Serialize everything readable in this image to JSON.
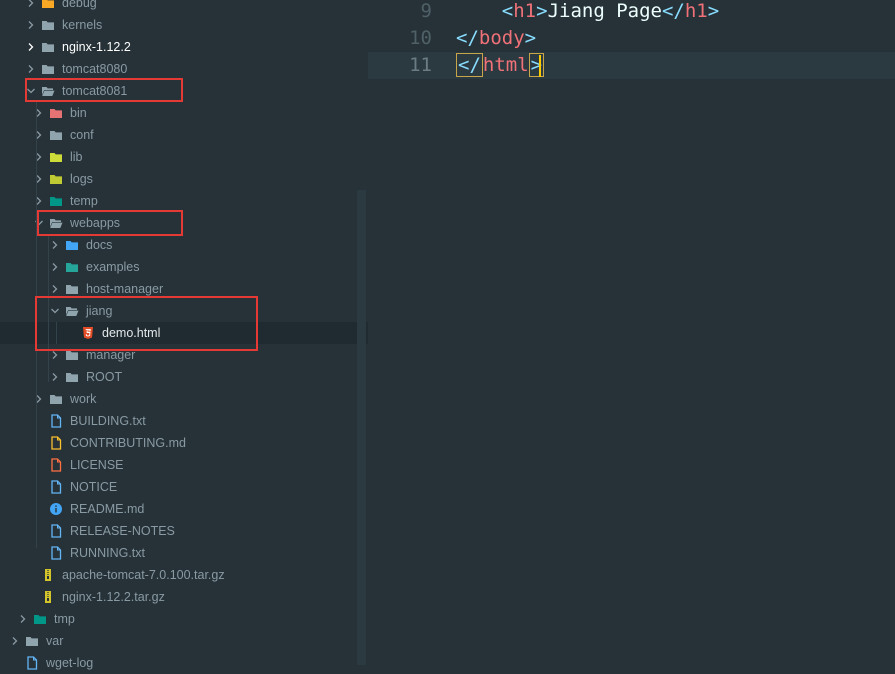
{
  "explorer": {
    "items": [
      {
        "label": "debug",
        "icon": "debug-folder-icon",
        "expanded": false
      },
      {
        "label": "kernels",
        "icon": "folder-icon",
        "expanded": false
      },
      {
        "label": "nginx-1.12.2",
        "icon": "folder-icon",
        "expanded": false
      },
      {
        "label": "tomcat8080",
        "icon": "folder-icon",
        "expanded": false
      },
      {
        "label": "tomcat8081",
        "icon": "folder-open-icon",
        "expanded": true
      },
      {
        "label": "bin",
        "icon": "bin-folder-icon",
        "expanded": false
      },
      {
        "label": "conf",
        "icon": "folder-icon",
        "expanded": false
      },
      {
        "label": "lib",
        "icon": "lib-folder-icon",
        "expanded": false
      },
      {
        "label": "logs",
        "icon": "logs-folder-icon",
        "expanded": false
      },
      {
        "label": "temp",
        "icon": "temp-folder-icon",
        "expanded": false
      },
      {
        "label": "webapps",
        "icon": "folder-open-icon",
        "expanded": true
      },
      {
        "label": "docs",
        "icon": "docs-folder-icon",
        "expanded": false
      },
      {
        "label": "examples",
        "icon": "examples-folder-icon",
        "expanded": false
      },
      {
        "label": "host-manager",
        "icon": "folder-icon",
        "expanded": false
      },
      {
        "label": "jiang",
        "icon": "folder-open-icon",
        "expanded": true
      },
      {
        "label": "demo.html",
        "icon": "html5-file-icon"
      },
      {
        "label": "manager",
        "icon": "folder-icon",
        "expanded": false
      },
      {
        "label": "ROOT",
        "icon": "folder-icon",
        "expanded": false
      },
      {
        "label": "work",
        "icon": "folder-icon",
        "expanded": false
      },
      {
        "label": "BUILDING.txt",
        "icon": "text-file-icon"
      },
      {
        "label": "CONTRIBUTING.md",
        "icon": "contributing-file-icon"
      },
      {
        "label": "LICENSE",
        "icon": "license-file-icon"
      },
      {
        "label": "NOTICE",
        "icon": "text-file-icon"
      },
      {
        "label": "README.md",
        "icon": "info-file-icon"
      },
      {
        "label": "RELEASE-NOTES",
        "icon": "text-file-icon"
      },
      {
        "label": "RUNNING.txt",
        "icon": "text-file-icon"
      },
      {
        "label": "apache-tomcat-7.0.100.tar.gz",
        "icon": "archive-file-icon"
      },
      {
        "label": "nginx-1.12.2.tar.gz",
        "icon": "archive-file-icon"
      },
      {
        "label": "tmp",
        "icon": "temp-folder-icon",
        "expanded": false
      },
      {
        "label": "var",
        "icon": "folder-icon",
        "expanded": false
      },
      {
        "label": "wget-log",
        "icon": "text-file-icon"
      }
    ]
  },
  "editor": {
    "lines": [
      {
        "number": "9",
        "parts": [
          {
            "t": "    ",
            "c": "txt"
          },
          {
            "t": "<",
            "c": "punct"
          },
          {
            "t": "h1",
            "c": "tag"
          },
          {
            "t": ">",
            "c": "punct"
          },
          {
            "t": "Jiang Page",
            "c": "txt"
          },
          {
            "t": "</",
            "c": "punct"
          },
          {
            "t": "h1",
            "c": "tag"
          },
          {
            "t": ">",
            "c": "punct"
          }
        ]
      },
      {
        "number": "10",
        "parts": [
          {
            "t": "</",
            "c": "punct"
          },
          {
            "t": "body",
            "c": "tag"
          },
          {
            "t": ">",
            "c": "punct"
          }
        ]
      },
      {
        "number": "11",
        "parts": [
          {
            "t": "</",
            "c": "punct"
          },
          {
            "t": "html",
            "c": "tag"
          },
          {
            "t": ">",
            "c": "punct"
          }
        ]
      }
    ]
  },
  "colors": {
    "background": "#263238",
    "highlight_box": "#e53935",
    "tag": "#f07178",
    "punct": "#89ddff"
  }
}
